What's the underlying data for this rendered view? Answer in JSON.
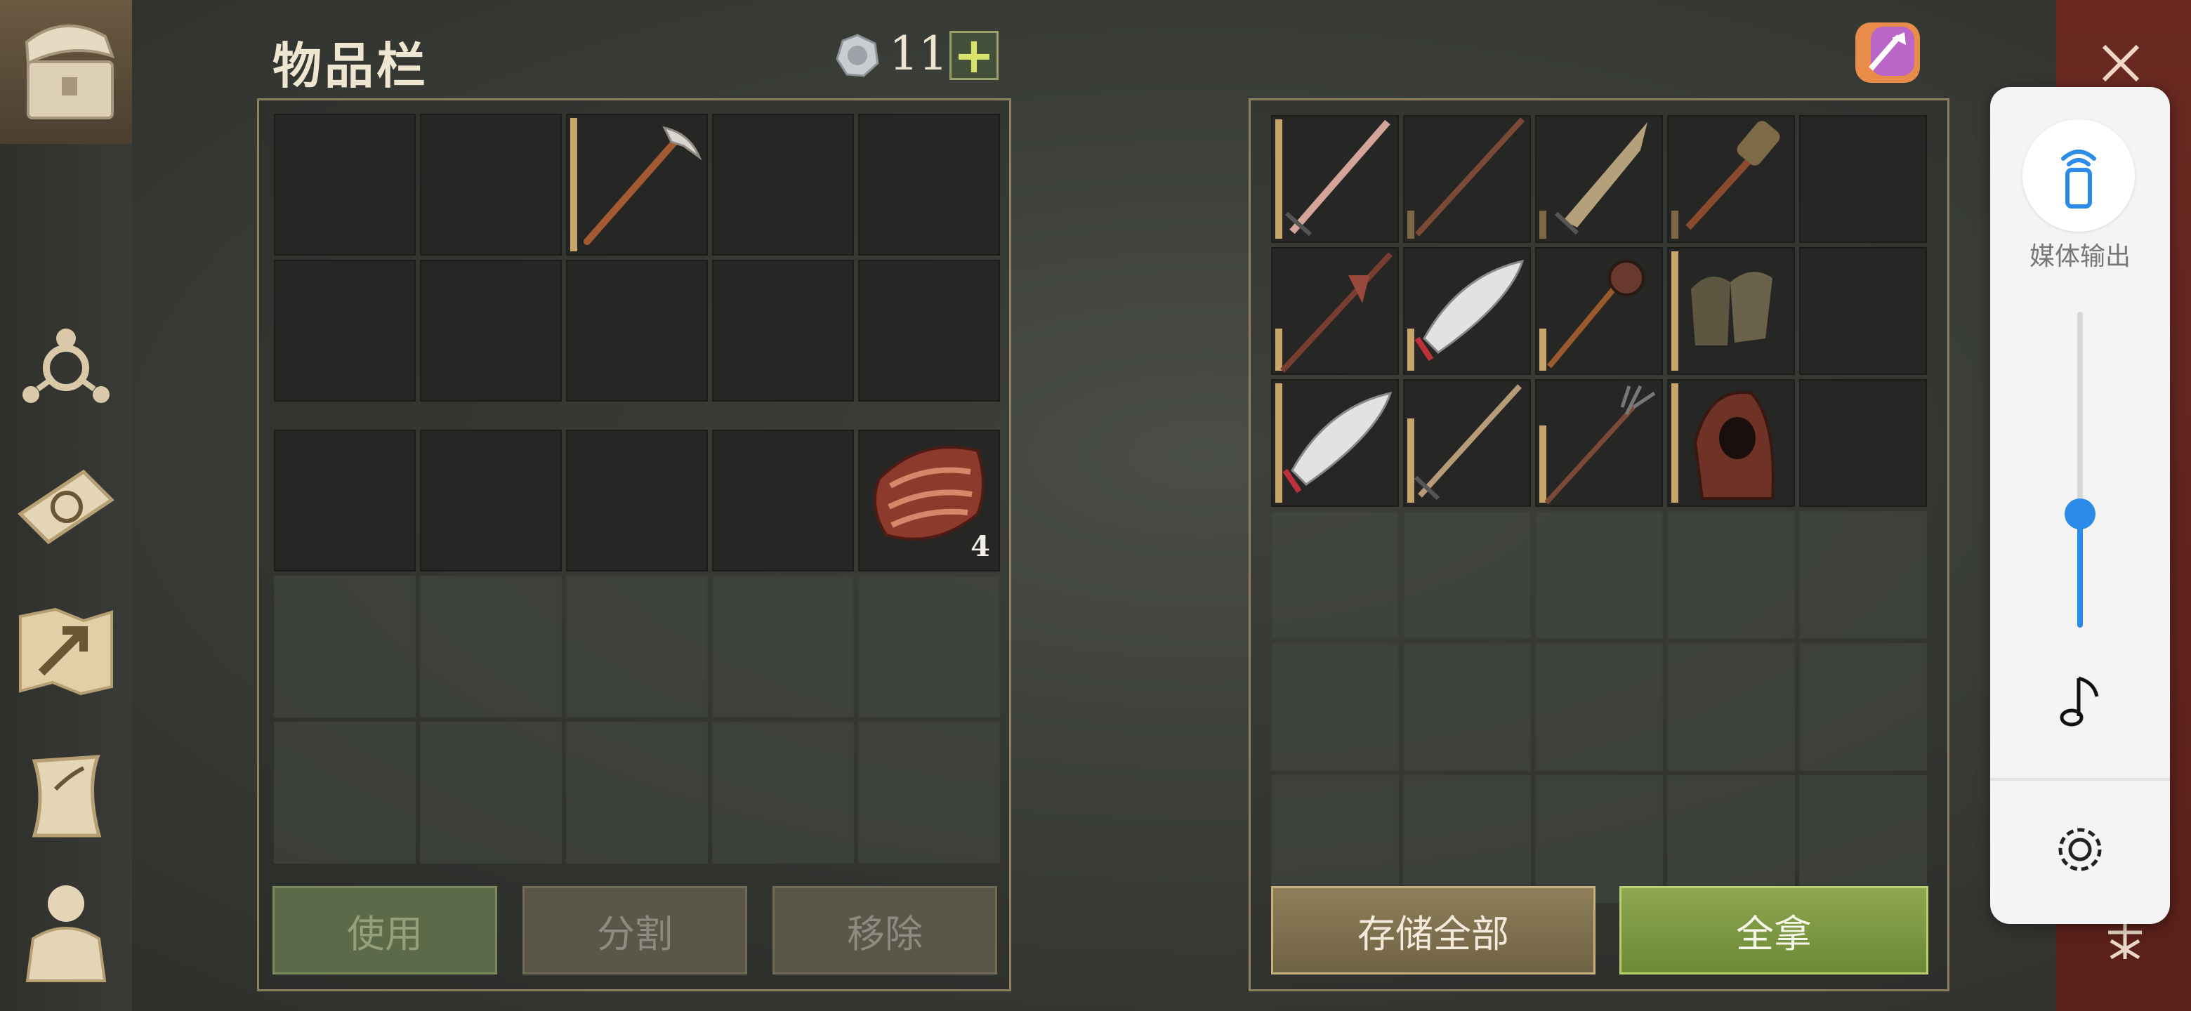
{
  "inventory": {
    "title": "物品栏",
    "coins": "11",
    "plus_label": "+"
  },
  "backpack": {
    "rows": [
      [
        {
          "item": ""
        },
        {
          "item": ""
        },
        {
          "item": "pickaxe"
        },
        {
          "item": ""
        },
        {
          "item": ""
        }
      ],
      [
        {
          "item": ""
        },
        {
          "item": ""
        },
        {
          "item": ""
        },
        {
          "item": ""
        },
        {
          "item": ""
        }
      ]
    ]
  },
  "storage_rows": [
    [
      {
        "item": ""
      },
      {
        "item": ""
      },
      {
        "item": ""
      },
      {
        "item": ""
      },
      {
        "item": "meat",
        "count": "4"
      }
    ],
    [
      {
        "item": ""
      },
      {
        "item": ""
      },
      {
        "item": ""
      },
      {
        "item": ""
      },
      {
        "item": ""
      }
    ],
    [
      {
        "item": ""
      },
      {
        "item": ""
      },
      {
        "item": ""
      },
      {
        "item": ""
      },
      {
        "item": ""
      }
    ]
  ],
  "actions": {
    "use": "使用",
    "split": "分割",
    "remove": "移除"
  },
  "container": {
    "items": [
      "sword",
      "spear",
      "saber",
      "torch",
      "",
      "halberd",
      "scimitar",
      "mace",
      "gloves",
      "",
      "scimitar-2",
      "sword-2",
      "pitchfork",
      "hood",
      ""
    ],
    "store_all": "存储全部",
    "take_all": "全拿"
  },
  "media_panel": {
    "output_label": "媒体输出",
    "volume": 0.36
  },
  "colors": {
    "accent": "#c8a56a",
    "take_all": "#8aa24e",
    "media_blue": "#2a8be8"
  }
}
